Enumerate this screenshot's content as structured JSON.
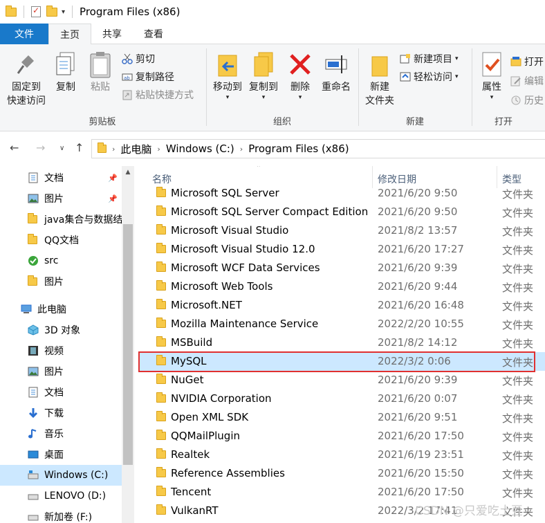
{
  "window": {
    "title": "Program Files (x86)"
  },
  "tabs": {
    "file": "文件",
    "home": "主页",
    "share": "共享",
    "view": "查看"
  },
  "ribbon": {
    "clipboard": {
      "label": "剪贴板",
      "pin": "固定到\n快速访问",
      "pin_l1": "固定到",
      "pin_l2": "快速访问",
      "copy": "复制",
      "paste": "粘贴",
      "cut": "剪切",
      "copy_path": "复制路径",
      "paste_shortcut": "粘贴快捷方式"
    },
    "organize": {
      "label": "组织",
      "move_to": "移动到",
      "copy_to": "复制到",
      "delete": "删除",
      "rename": "重命名"
    },
    "new": {
      "label": "新建",
      "new_folder_l1": "新建",
      "new_folder_l2": "文件夹",
      "new_item": "新建项目",
      "easy_access": "轻松访问"
    },
    "open": {
      "label": "打开",
      "properties": "属性",
      "open": "打开",
      "edit": "编辑",
      "history": "历史"
    }
  },
  "address": {
    "crumbs": [
      "此电脑",
      "Windows (C:)",
      "Program Files (x86)"
    ]
  },
  "nav": {
    "items": [
      {
        "label": "文档",
        "pinned": true
      },
      {
        "label": "图片",
        "pinned": true
      },
      {
        "label": "java集合与数据结"
      },
      {
        "label": "QQ文档"
      },
      {
        "label": "src"
      },
      {
        "label": "图片"
      },
      {
        "label": "此电脑"
      },
      {
        "label": "3D 对象"
      },
      {
        "label": "视频"
      },
      {
        "label": "图片"
      },
      {
        "label": "文档"
      },
      {
        "label": "下载"
      },
      {
        "label": "音乐"
      },
      {
        "label": "桌面"
      },
      {
        "label": "Windows (C:)"
      },
      {
        "label": "LENOVO (D:)"
      },
      {
        "label": "新加卷 (F:)"
      }
    ]
  },
  "columns": {
    "name": "名称",
    "date": "修改日期",
    "type": "类型"
  },
  "files": [
    {
      "name": "Microsoft SQL Server",
      "date": "2021/6/20 9:50",
      "type": "文件夹"
    },
    {
      "name": "Microsoft SQL Server Compact Edition",
      "date": "2021/6/20 9:50",
      "type": "文件夹"
    },
    {
      "name": "Microsoft Visual Studio",
      "date": "2021/8/2 13:57",
      "type": "文件夹"
    },
    {
      "name": "Microsoft Visual Studio 12.0",
      "date": "2021/6/20 17:27",
      "type": "文件夹"
    },
    {
      "name": "Microsoft WCF Data Services",
      "date": "2021/6/20 9:39",
      "type": "文件夹"
    },
    {
      "name": "Microsoft Web Tools",
      "date": "2021/6/20 9:44",
      "type": "文件夹"
    },
    {
      "name": "Microsoft.NET",
      "date": "2021/6/20 16:48",
      "type": "文件夹"
    },
    {
      "name": "Mozilla Maintenance Service",
      "date": "2022/2/20 10:55",
      "type": "文件夹"
    },
    {
      "name": "MSBuild",
      "date": "2021/8/2 14:12",
      "type": "文件夹"
    },
    {
      "name": "MySQL",
      "date": "2022/3/2 0:06",
      "type": "文件夹",
      "selected": true
    },
    {
      "name": "NuGet",
      "date": "2021/6/20 9:39",
      "type": "文件夹"
    },
    {
      "name": "NVIDIA Corporation",
      "date": "2021/6/20 0:07",
      "type": "文件夹"
    },
    {
      "name": "Open XML SDK",
      "date": "2021/6/20 9:51",
      "type": "文件夹"
    },
    {
      "name": "QQMailPlugin",
      "date": "2021/6/20 17:50",
      "type": "文件夹"
    },
    {
      "name": "Realtek",
      "date": "2021/6/19 23:51",
      "type": "文件夹"
    },
    {
      "name": "Reference Assemblies",
      "date": "2021/6/20 15:50",
      "type": "文件夹"
    },
    {
      "name": "Tencent",
      "date": "2021/6/20 17:50",
      "type": "文件夹"
    },
    {
      "name": "VulkanRT",
      "date": "2022/3/2 17:41",
      "type": "文件夹"
    }
  ],
  "watermark": "CSDN @只爱吃土豆",
  "colors": {
    "accent": "#1979ca",
    "selection": "#cce8ff",
    "highlight_border": "#e03030"
  }
}
